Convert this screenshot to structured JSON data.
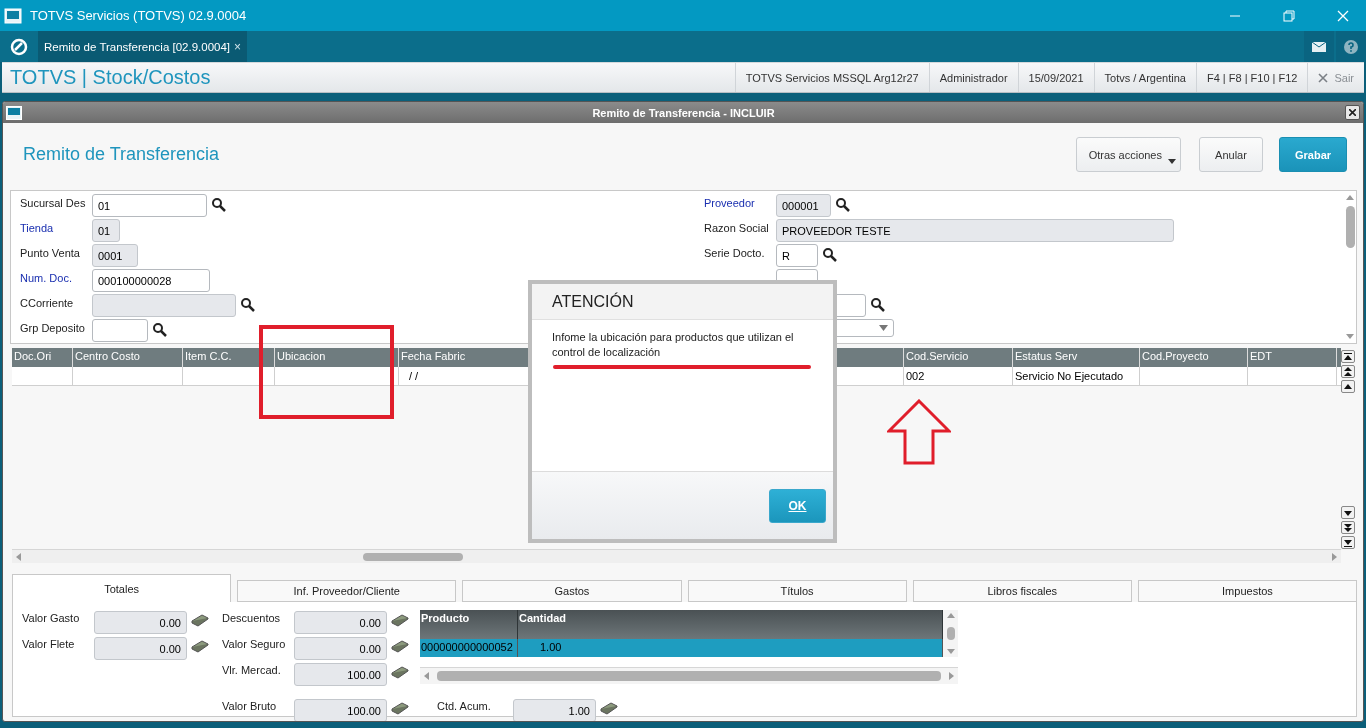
{
  "window": {
    "title": "TOTVS Servicios (TOTVS) 02.9.0004"
  },
  "app_tabs": [
    {
      "label": "Remito de Transferencia [02.9.0004]",
      "close": "×",
      "selected": true
    }
  ],
  "header": {
    "title": "TOTVS | Stock/Costos",
    "info": [
      "TOTVS Servicios MSSQL Arg12r27",
      "Administrador",
      "15/09/2021",
      "Totvs / Argentina",
      "F4 | F8 | F10 | F12"
    ],
    "exit": "Sair"
  },
  "dialog": {
    "title": "Remito de Transferencia - INCLUIR",
    "heading": "Remito de Transferencia",
    "buttons": [
      {
        "label": "Otras acciones",
        "kind": "menu"
      },
      {
        "label": "Anular",
        "kind": "plain"
      },
      {
        "label": "Grabar",
        "kind": "primary"
      }
    ]
  },
  "form": {
    "left": [
      {
        "label": "Sucursal Des",
        "value": "01",
        "required": false,
        "disabled": false,
        "lookup": true
      },
      {
        "label": "Tienda",
        "value": "01",
        "required": true,
        "disabled": true,
        "lookup": false
      },
      {
        "label": "Punto Venta",
        "value": "0001",
        "required": false,
        "disabled": true,
        "lookup": false
      },
      {
        "label": "Num. Doc.",
        "value": "000100000028",
        "required": true,
        "disabled": false,
        "lookup": false
      },
      {
        "label": "CCorriente",
        "required": false,
        "disabled": true,
        "lookup": true
      },
      {
        "label": "Grp Deposito",
        "required": false,
        "disabled": false,
        "lookup": true
      }
    ],
    "right": [
      {
        "label": "Proveedor",
        "value": "000001",
        "required": true,
        "disabled": true,
        "lookup": true
      },
      {
        "label": "Razon Social",
        "value": "PROVEEDOR TESTE",
        "required": false,
        "disabled": true,
        "lookup": false
      },
      {
        "label": "Serie Docto.",
        "value": "R",
        "required": false,
        "disabled": false,
        "lookup": true
      }
    ]
  },
  "grid": {
    "columns": [
      {
        "label": "Doc.Ori"
      },
      {
        "label": "Centro Costo"
      },
      {
        "label": "Item C.C."
      },
      {
        "label": "Ubicacion"
      },
      {
        "label": "Fecha Fabric"
      },
      {},
      {
        "label": "Cod.Servicio"
      },
      {
        "label": "Estatus Serv"
      },
      {
        "label": "Cod.Proyecto"
      },
      {
        "label": "EDT"
      }
    ],
    "rows": [
      {
        "cells": [
          null,
          null,
          null,
          null,
          "/ /",
          null,
          "002",
          "Servicio No Ejecutado",
          null,
          null
        ]
      }
    ]
  },
  "bottom_tabs": [
    {
      "label": "Totales",
      "selected": true
    },
    {
      "label": "Inf. Proveedor/Cliente",
      "selected": false
    },
    {
      "label": "Gastos",
      "selected": false
    },
    {
      "label": "Títulos",
      "selected": false
    },
    {
      "label": "Libros fiscales",
      "selected": false
    },
    {
      "label": "Impuestos",
      "selected": false
    }
  ],
  "totals": {
    "left": [
      {
        "label": "Valor Gasto",
        "value": "0.00"
      },
      {
        "label": "Valor Flete",
        "value": "0.00"
      }
    ],
    "middle": [
      {
        "label": "Descuentos",
        "value": "0.00"
      },
      {
        "label": "Valor Seguro",
        "value": "0.00"
      },
      {
        "label": "Vlr. Mercad.",
        "value": "100.00"
      }
    ],
    "bottom": [
      {
        "label": "Valor Bruto",
        "value": "100.00"
      },
      {
        "label": "Ctd. Acum.",
        "value": "1.00"
      }
    ],
    "products": {
      "columns": [
        "Producto",
        "Cantidad"
      ],
      "rows": [
        {
          "producto": "000000000000052",
          "cantidad": "1.00",
          "selected": true
        }
      ]
    }
  },
  "alert": {
    "title": "ATENCIÓN",
    "message": "Infome la ubicación para productos que utilizan el control de localización",
    "button": "OK"
  }
}
